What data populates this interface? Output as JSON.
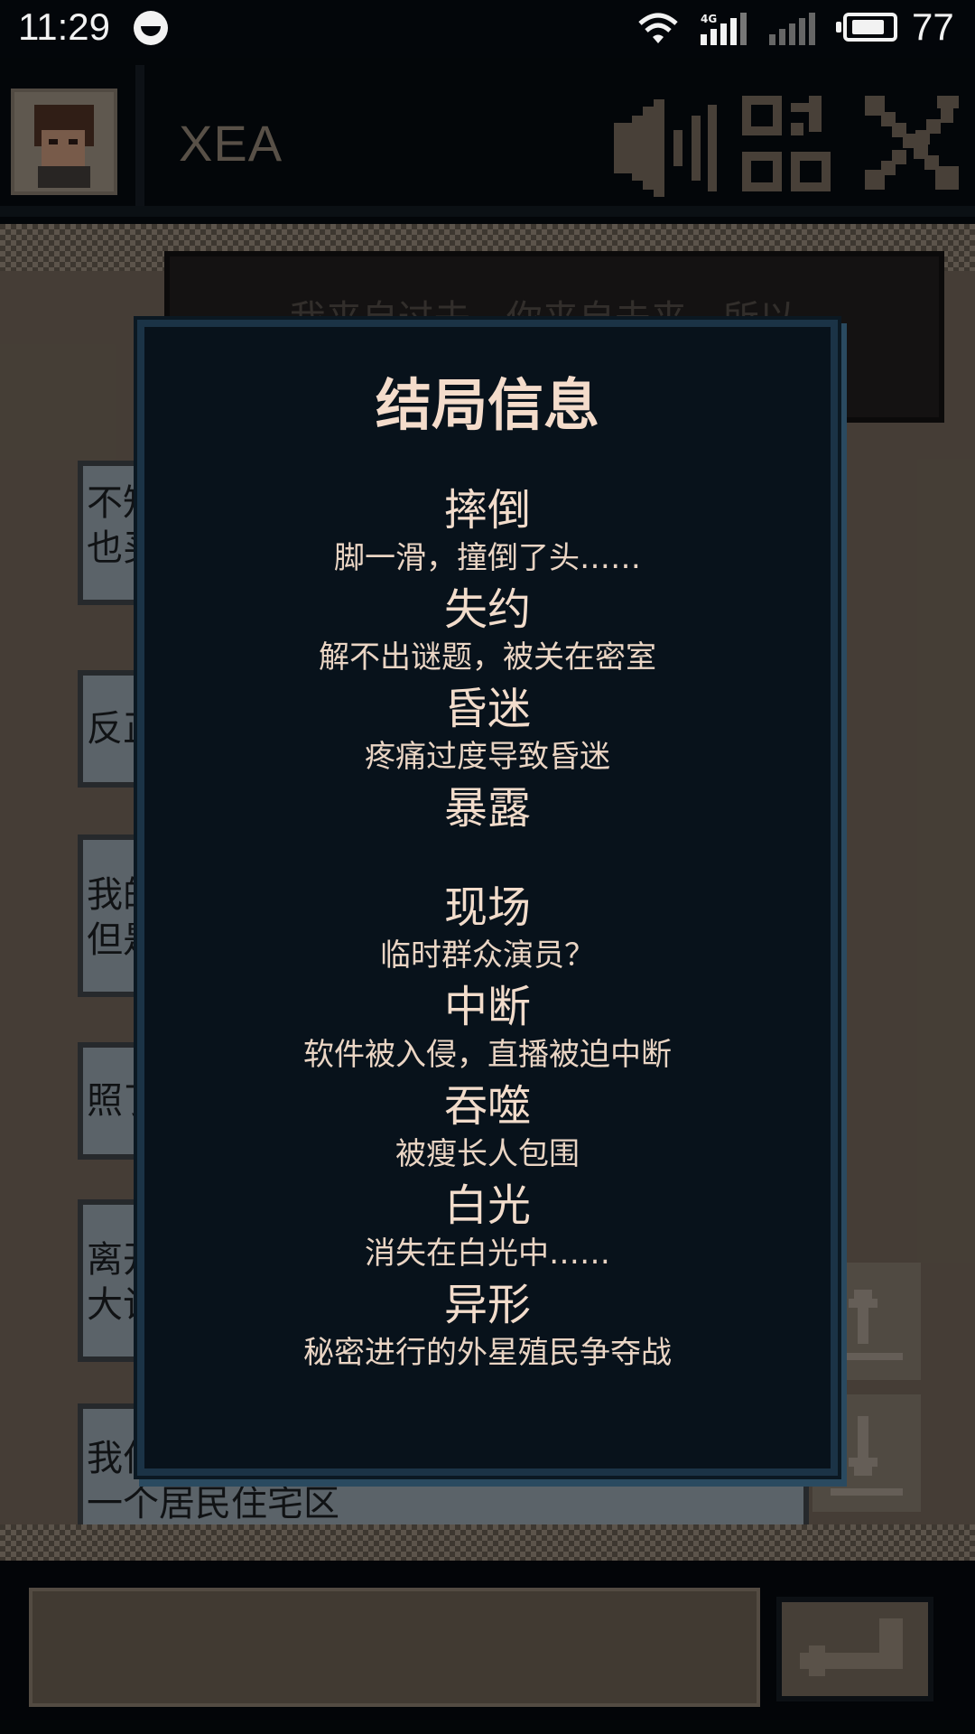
{
  "status_bar": {
    "time": "11:29",
    "network_label": "4G",
    "battery_level": "77",
    "battery_fraction": 0.77
  },
  "header": {
    "contact_name": "XEA",
    "icons": [
      "avatar-portrait",
      "speaker-icon",
      "qr-code-icon",
      "tools-icon"
    ]
  },
  "chat": {
    "messages": [
      {
        "side": "right",
        "lines": [
          "… 我来自过去，你来自未来，所以"
        ]
      },
      {
        "side": "left",
        "lines": [
          "不知",
          "也买"
        ]
      },
      {
        "side": "left",
        "lines": [
          "反正"
        ]
      },
      {
        "side": "left",
        "lines": [
          "我的",
          "但是"
        ]
      },
      {
        "side": "left",
        "lines": [
          "照了"
        ]
      },
      {
        "side": "left",
        "lines": [
          "离开",
          "大记"
        ]
      },
      {
        "side": "left",
        "lines": [
          "我住",
          "一个居民住宅区"
        ]
      }
    ],
    "scroll_up_icon": "arrow-up-icon",
    "scroll_down_icon": "arrow-down-icon"
  },
  "input": {
    "value": "",
    "send_icon": "enter-icon"
  },
  "modal": {
    "title": "结局信息",
    "endings": [
      {
        "name": "摔倒",
        "desc": "脚一滑，撞倒了头……"
      },
      {
        "name": "失约",
        "desc": "解不出谜题，被关在密室"
      },
      {
        "name": "昏迷",
        "desc": "疼痛过度导致昏迷"
      },
      {
        "name": "暴露",
        "desc": ""
      },
      {
        "name": "现场",
        "desc": "临时群众演员？"
      },
      {
        "name": "中断",
        "desc": "软件被入侵，直播被迫中断"
      },
      {
        "name": "吞噬",
        "desc": "被瘦长人包围"
      },
      {
        "name": "白光",
        "desc": "消失在白光中……"
      },
      {
        "name": "异形",
        "desc": "秘密进行的外星殖民争夺战"
      }
    ]
  },
  "colors": {
    "modal_bg": "#08121b",
    "modal_border": "#1b3346",
    "modal_text": "#f2dccb",
    "chat_bg": "#6a5f53",
    "bubble_left": "#8c98a2"
  }
}
